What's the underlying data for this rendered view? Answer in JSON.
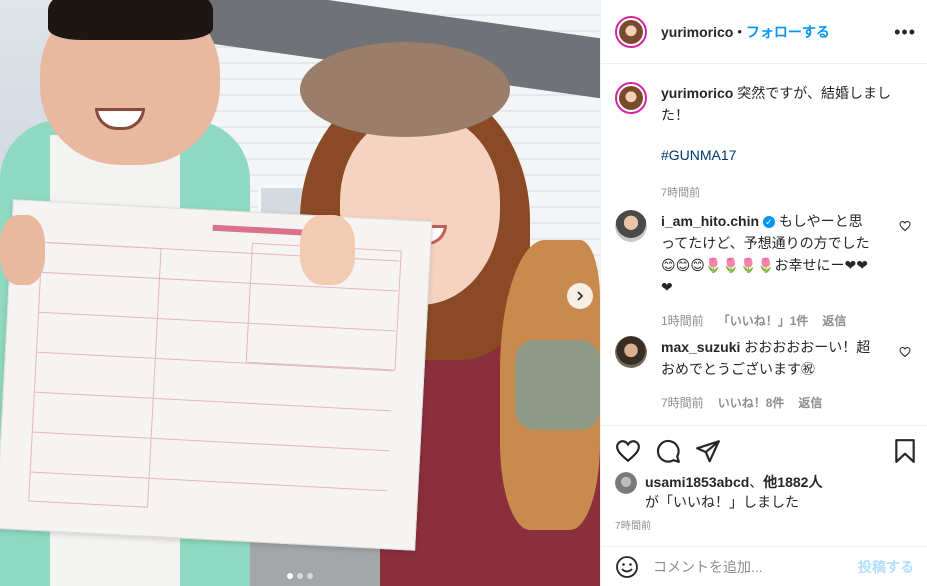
{
  "post": {
    "author": "yurimorico",
    "follow_label": "フォローする",
    "separator": "•",
    "more_label": "•••",
    "caption_username": "yurimorico",
    "caption_text": "突然ですが、結婚しました！",
    "hashtag": "#GUNMA17",
    "caption_time": "7時間前"
  },
  "comments": [
    {
      "username": "i_am_hito.chin",
      "verified": true,
      "text": "もしやーと思ってたけど、予想通りの方でした😊😊😊🌷🌷🌷🌷お幸せにー❤❤❤",
      "time": "1時間前",
      "likes": "「いいね！」1件",
      "reply": "返信"
    },
    {
      "username": "max_suzuki",
      "verified": false,
      "text": "おおおおおーい！超おめでとうございます㊗",
      "time": "7時間前",
      "likes": "いいね！8件",
      "reply": "返信"
    }
  ],
  "likes": {
    "user": "usami1853abcd",
    "others": "他1882人",
    "suffix_1": "、",
    "suffix_2": "が「いいね！」しました"
  },
  "post_time": "7時間前",
  "composer": {
    "placeholder": "コメントを追加...",
    "post_label": "投稿する"
  },
  "carousel": {
    "slide_count": 3,
    "active_index": 0
  },
  "colors": {
    "accent": "#0095f6",
    "hashtag": "#00376b",
    "muted": "#8e8e8e",
    "post_disabled": "#b2dffc"
  },
  "icons": [
    "heart-icon",
    "comment-icon",
    "share-icon",
    "bookmark-icon",
    "emoji-icon",
    "next-arrow-icon",
    "verified-icon",
    "more-options-icon"
  ]
}
